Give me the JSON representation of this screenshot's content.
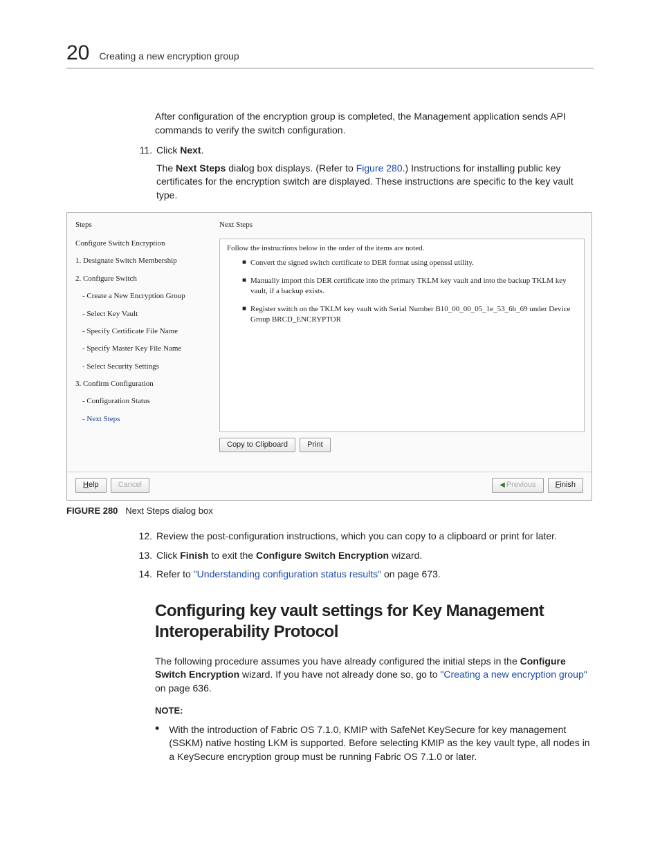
{
  "header": {
    "chapter_number": "20",
    "chapter_title": "Creating a new encryption group"
  },
  "body": {
    "intro_para": "After configuration of the encryption group is completed, the Management application sends API commands to verify the switch configuration.",
    "step11": {
      "num": "11.",
      "text_a": "Click ",
      "text_b": "Next",
      "text_c": ".",
      "sub_a": "The ",
      "sub_b": "Next Steps",
      "sub_c": " dialog box displays. (Refer to ",
      "sub_link": "Figure 280",
      "sub_d": ".) Instructions for installing public key certificates for the encryption switch are displayed. These instructions are specific to the key vault type."
    }
  },
  "dialog": {
    "steps_label": "Steps",
    "next_label": "Next Steps",
    "steps": {
      "s0": "Configure Switch Encryption",
      "s1": "1. Designate Switch Membership",
      "s2": "2. Configure Switch",
      "s2a": "- Create a New Encryption Group",
      "s2b": "- Select Key Vault",
      "s2c": "- Specify Certificate File Name",
      "s2d": "- Specify Master Key File Name",
      "s2e": "- Select Security Settings",
      "s3": "3. Confirm Configuration",
      "s3a": "- Configuration Status",
      "s3b": "- Next Steps"
    },
    "inst_header": "Follow the instructions below in the order of the items are noted.",
    "inst1": "Convert the signed switch certificate to DER format using openssl utility.",
    "inst2": "Manually import this DER certificate into the primary TKLM key vault and into the backup TKLM key vault, if a backup exists.",
    "inst3": "Register switch on the TKLM key vault with Serial Number B10_00_00_05_1e_53_6b_69 under Device Group BRCD_ENCRYPTOR",
    "btn_copy": "Copy to Clipboard",
    "btn_print": "Print",
    "btn_help": "Help",
    "btn_cancel": "Cancel",
    "btn_prev": "Previous",
    "btn_finish": "Finish"
  },
  "figcap": {
    "label": "FIGURE 280",
    "text": "Next Steps dialog box"
  },
  "step12": {
    "num": "12.",
    "text": "Review the post-configuration instructions, which you can copy to a clipboard or print for later."
  },
  "step13": {
    "num": "13.",
    "a": "Click ",
    "b": "Finish",
    "c": " to exit the ",
    "d": "Configure Switch Encryption",
    "e": " wizard."
  },
  "step14": {
    "num": "14.",
    "a": "Refer to ",
    "link": "\"Understanding configuration status results\"",
    "b": " on page 673."
  },
  "h2": "Configuring key vault settings for Key Management Interoperability Protocol",
  "para2": {
    "a": "The following procedure assumes you have already configured the initial steps in the ",
    "b": "Configure Switch Encryption",
    "c": " wizard. If you have not already done so, go to ",
    "link": "\"Creating a new encryption group\"",
    "d": " on page 636."
  },
  "note_label": "NOTE:",
  "note_bullet": "With the introduction of Fabric OS 7.1.0, KMIP with SafeNet KeySecure for key management (SSKM) native hosting LKM is supported. Before selecting KMIP as the key vault type, all nodes in a KeySecure encryption group must be running Fabric OS 7.1.0 or later."
}
